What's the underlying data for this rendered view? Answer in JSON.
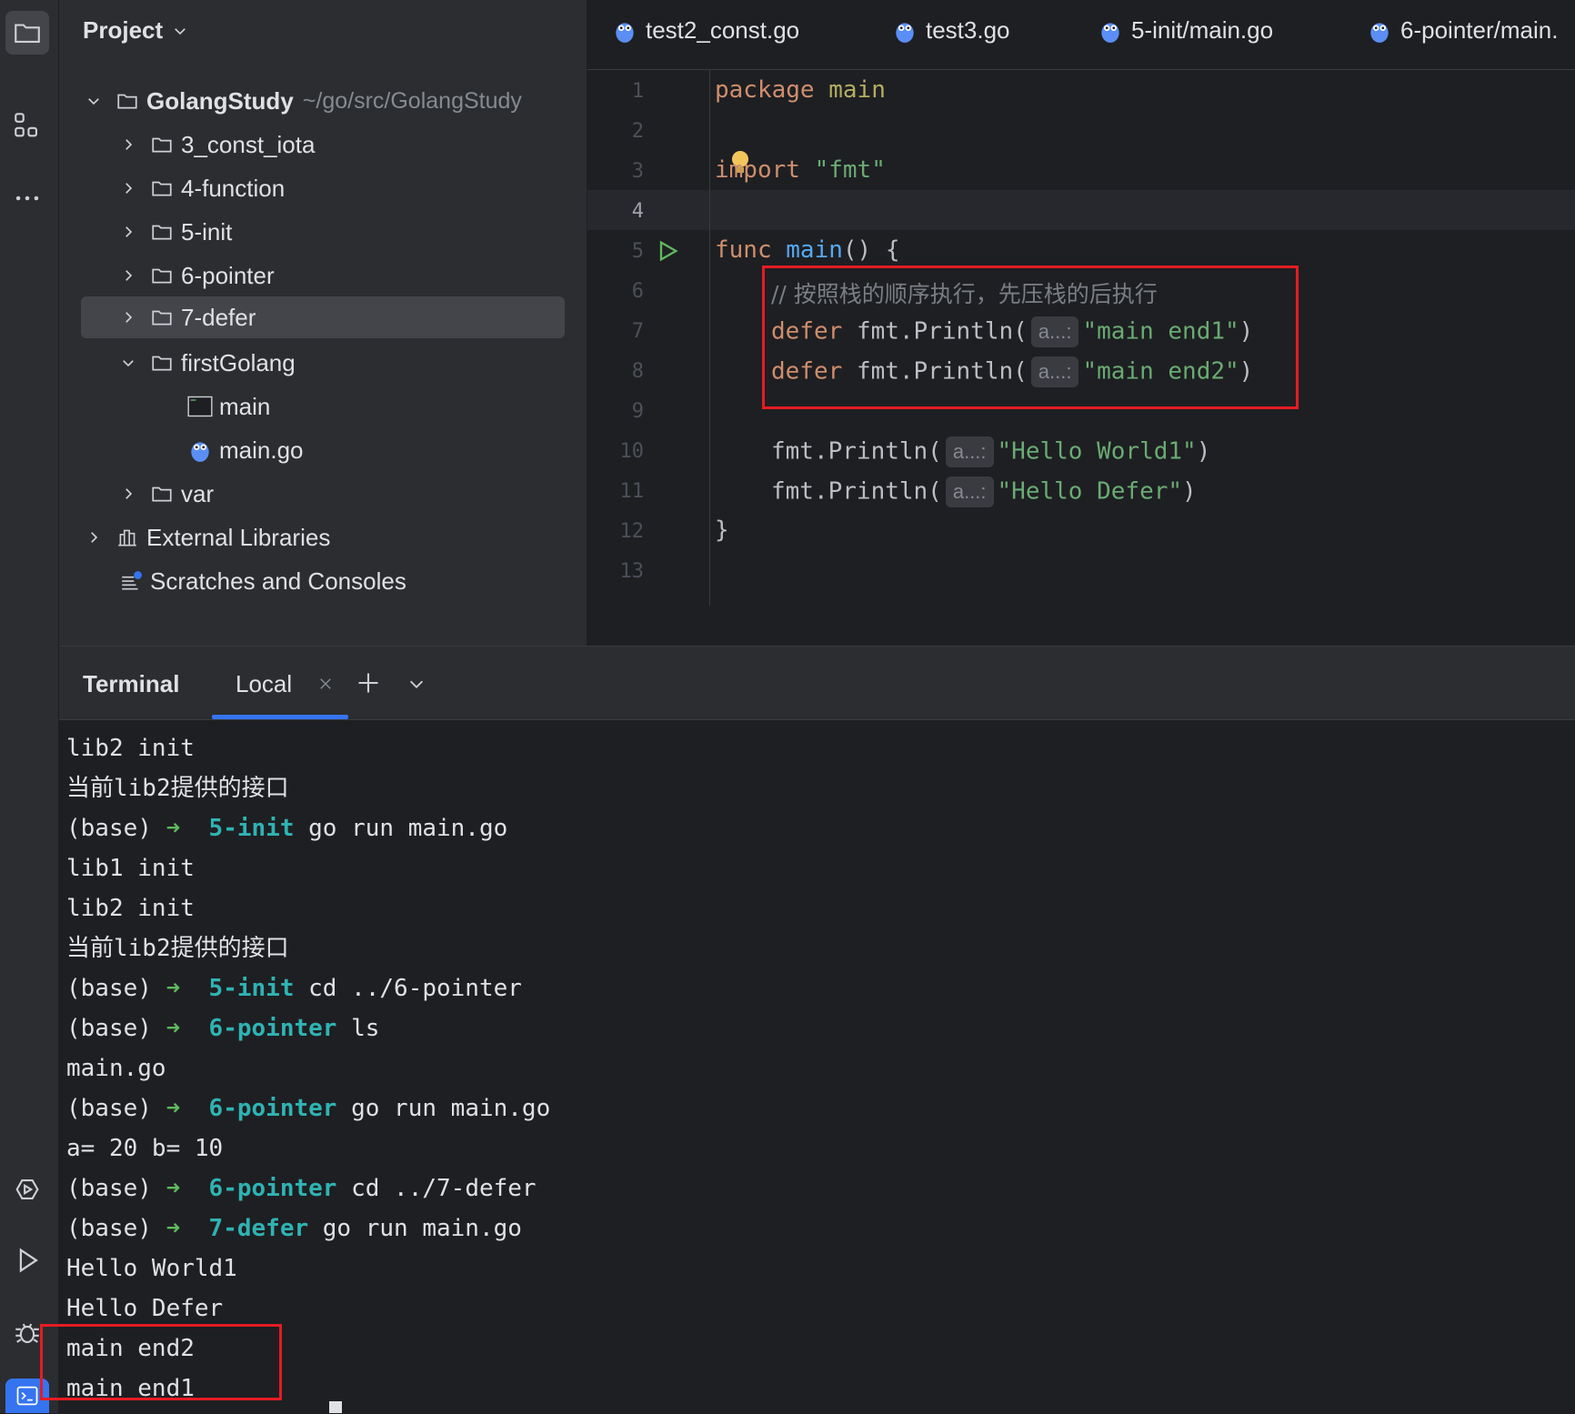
{
  "project_panel": {
    "title": "Project",
    "tree": [
      {
        "label": "GolangStudy",
        "path": "~/go/src/GolangStudy"
      },
      {
        "label": "3_const_iota"
      },
      {
        "label": "4-function"
      },
      {
        "label": "5-init"
      },
      {
        "label": "6-pointer"
      },
      {
        "label": "7-defer"
      },
      {
        "label": "firstGolang"
      },
      {
        "label": "main"
      },
      {
        "label": "main.go"
      },
      {
        "label": "var"
      },
      {
        "label": "External Libraries"
      },
      {
        "label": "Scratches and Consoles"
      }
    ]
  },
  "editor": {
    "tabs": [
      "test2_const.go",
      "test3.go",
      "5-init/main.go",
      "6-pointer/main."
    ],
    "line_numbers": [
      "1",
      "2",
      "3",
      "4",
      "5",
      "6",
      "7",
      "8",
      "9",
      "10",
      "11",
      "12",
      "13"
    ],
    "code": {
      "l1_kw": "package",
      "l1_name": "main",
      "l3_kw": "import",
      "l3_str": "\"fmt\"",
      "l5_kw": "func",
      "l5_fn": "main",
      "l5_rest": "() {",
      "l6_comment": "// 按照栈的顺序执行，先压栈的后执行",
      "l7_kw": "defer",
      "l7_call": "fmt.Println(",
      "l7_hint": "a...:",
      "l7_str": "\"main end1\"",
      "l7_end": ")",
      "l8_kw": "defer",
      "l8_call": "fmt.Println(",
      "l8_hint": "a...:",
      "l8_str": "\"main end2\"",
      "l8_end": ")",
      "l10_call": "fmt.Println(",
      "l10_hint": "a...:",
      "l10_str": "\"Hello World1\"",
      "l10_end": ")",
      "l11_call": "fmt.Println(",
      "l11_hint": "a...:",
      "l11_str": "\"Hello Defer\"",
      "l11_end": ")",
      "l12": "}"
    }
  },
  "terminal": {
    "title": "Terminal",
    "tab_label": "Local",
    "lines": [
      {
        "text": "lib2 init"
      },
      {
        "text": "当前lib2提供的接口"
      },
      {
        "prefix": "(base) ",
        "arrow": "➜",
        "dir": "5-init",
        "cmd": " go run main.go"
      },
      {
        "text": "lib1 init"
      },
      {
        "text": "lib2 init"
      },
      {
        "text": "当前lib2提供的接口"
      },
      {
        "prefix": "(base) ",
        "arrow": "➜",
        "dir": "5-init",
        "cmd": " cd ../6-pointer"
      },
      {
        "prefix": "(base) ",
        "arrow": "➜",
        "dir": "6-pointer",
        "cmd": " ls"
      },
      {
        "text": "main.go"
      },
      {
        "prefix": "(base) ",
        "arrow": "➜",
        "dir": "6-pointer",
        "cmd": " go run main.go"
      },
      {
        "text": "a= 20 b= 10"
      },
      {
        "prefix": "(base) ",
        "arrow": "➜",
        "dir": "6-pointer",
        "cmd": " cd ../7-defer"
      },
      {
        "prefix": "(base) ",
        "arrow": "➜",
        "dir": "7-defer",
        "cmd": " go run main.go"
      },
      {
        "text": "Hello World1"
      },
      {
        "text": "Hello Defer"
      },
      {
        "text": "main end2"
      },
      {
        "text": "main end1"
      }
    ]
  },
  "icons": {
    "stripe_top": [
      "folder-icon",
      "structure-icon",
      "more-icon"
    ],
    "stripe_bottom": [
      "services-icon",
      "run-icon",
      "debug-icon",
      "terminal-icon"
    ]
  },
  "colors": {
    "highlight_box": "#e51c23",
    "accent": "#3574f0"
  }
}
